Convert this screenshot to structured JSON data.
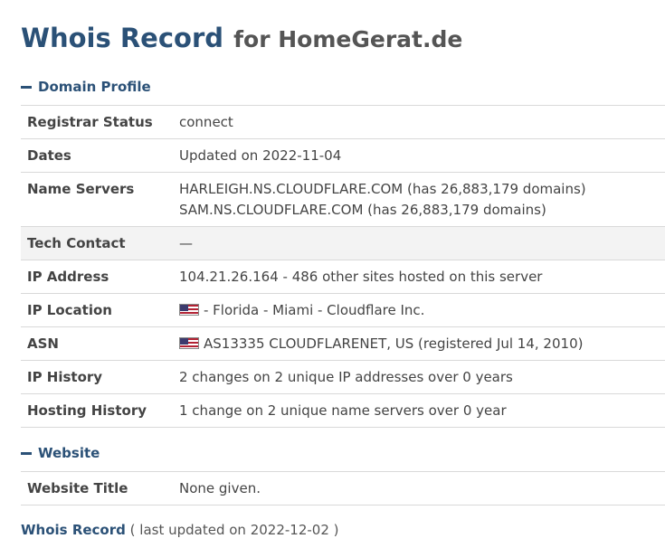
{
  "title": {
    "main": "Whois Record",
    "sub": "for HomeGerat.de"
  },
  "domain_profile": {
    "heading": "Domain Profile",
    "rows": {
      "registrar_status": {
        "label": "Registrar Status",
        "value": "connect"
      },
      "dates": {
        "label": "Dates",
        "value": "Updated on 2022-11-04"
      },
      "name_servers": {
        "label": "Name Servers",
        "line1": "HARLEIGH.NS.CLOUDFLARE.COM (has 26,883,179 domains)",
        "line2": "SAM.NS.CLOUDFLARE.COM (has 26,883,179 domains)"
      },
      "tech_contact": {
        "label": "Tech Contact",
        "value": "—"
      },
      "ip_address": {
        "label": "IP Address",
        "value": "104.21.26.164 - 486 other sites hosted on this server"
      },
      "ip_location": {
        "label": "IP Location",
        "value": "- Florida - Miami - Cloudflare Inc.",
        "flag": "us-flag-icon"
      },
      "asn": {
        "label": "ASN",
        "value": "AS13335 CLOUDFLARENET, US (registered Jul 14, 2010)",
        "flag": "us-flag-icon"
      },
      "ip_history": {
        "label": "IP History",
        "value": "2 changes on 2 unique IP addresses over 0 years"
      },
      "hosting_history": {
        "label": "Hosting History",
        "value": "1 change on 2 unique name servers over 0 year"
      }
    }
  },
  "website": {
    "heading": "Website",
    "rows": {
      "website_title": {
        "label": "Website Title",
        "value": "None given."
      }
    }
  },
  "footer": {
    "link": "Whois Record",
    "note": "( last updated on 2022-12-02 )"
  },
  "colors": {
    "accent": "#2b5177",
    "text": "#444444",
    "divider": "#d9d9d9",
    "shaded_row": "#f3f3f3"
  }
}
